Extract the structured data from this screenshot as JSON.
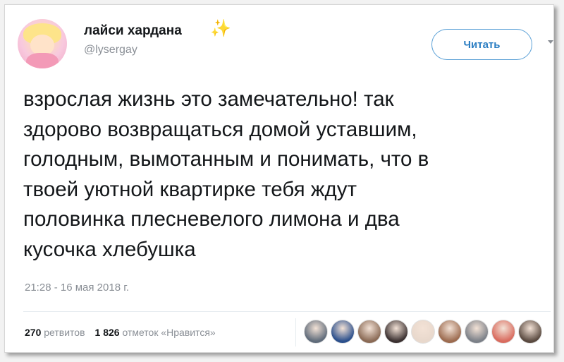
{
  "user": {
    "display_name": "лайси хардана",
    "handle": "@lysergay"
  },
  "icons": {
    "sparkle": "sparkle-icon",
    "chevron": "chevron-down-icon"
  },
  "follow_button": {
    "label": "Читать"
  },
  "tweet": {
    "text": "взрослая жизнь это замечательно! так\nздорово возвращаться домой уставшим,\nголодным, вымотанным и понимать, что в\nтвоей уютной квартирке тебя ждут\nполовинка плесневелого лимона и два\nкусочка хлебушка",
    "timestamp": "21:28 - 16 мая 2018 г."
  },
  "stats": {
    "retweets_count": "270",
    "retweets_label": "ретвитов",
    "likes_count": "1 826",
    "likes_label": "отметок «Нравится»"
  },
  "likers": [
    {
      "name": "liker-avatar-1",
      "color": "#5f6b7a"
    },
    {
      "name": "liker-avatar-2",
      "color": "#2b4f8c"
    },
    {
      "name": "liker-avatar-3",
      "color": "#8a6a55"
    },
    {
      "name": "liker-avatar-4",
      "color": "#3a3030"
    },
    {
      "name": "liker-avatar-5",
      "color": "#e8d8cc"
    },
    {
      "name": "liker-avatar-6",
      "color": "#9c6b4f"
    },
    {
      "name": "liker-avatar-7",
      "color": "#7b8088"
    },
    {
      "name": "liker-avatar-8",
      "color": "#d96b5e"
    },
    {
      "name": "liker-avatar-9",
      "color": "#5a4a40"
    }
  ],
  "colors": {
    "accent": "#2a7dc2",
    "text": "#14171a",
    "muted": "#8a8f96"
  }
}
